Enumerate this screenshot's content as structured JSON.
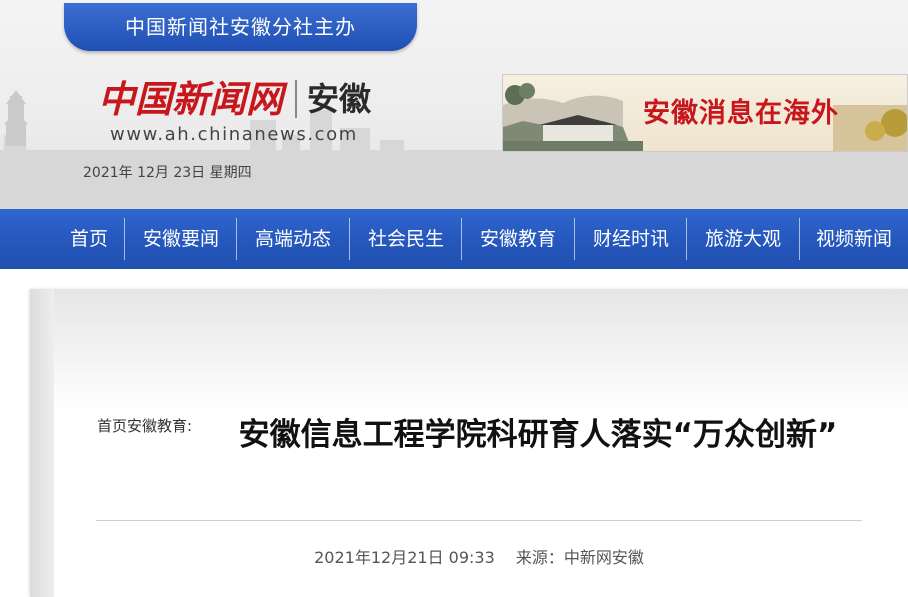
{
  "header": {
    "org_banner": "中国新闻社安徽分社主办",
    "logo_cn": "中国新闻网",
    "logo_region": "安徽",
    "logo_url": "www.ah.chinanews.com",
    "date": "2021年 12月 23日   星期四",
    "ad_banner_text": "安徽消息在海外"
  },
  "nav": {
    "items": [
      "首页",
      "安徽要闻",
      "高端动态",
      "社会民生",
      "安徽教育",
      "财经时讯",
      "旅游大观",
      "视频新闻"
    ]
  },
  "article": {
    "breadcrumb": "首页安徽教育:",
    "title": "安徽信息工程学院科研育人落实“万众创新”",
    "datetime": "2021年12月21日 09:33",
    "source": "来源：中新网安徽"
  },
  "colors": {
    "nav_blue": "#2557bd",
    "logo_red": "#c8161d"
  }
}
